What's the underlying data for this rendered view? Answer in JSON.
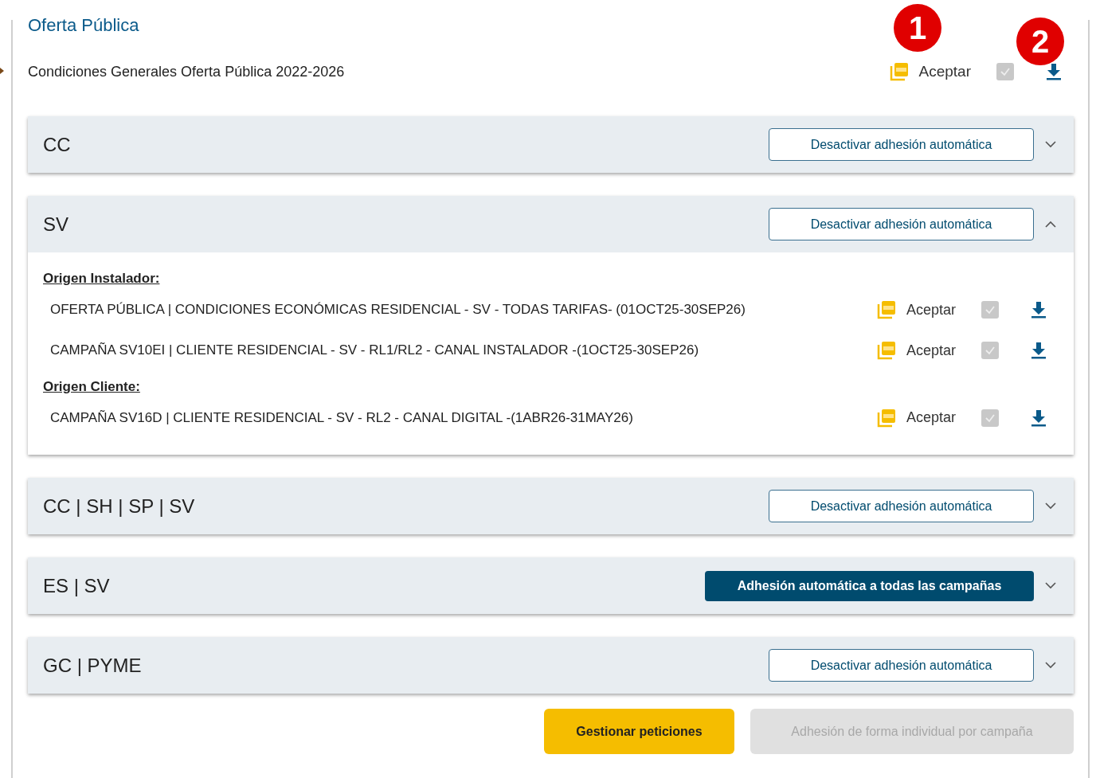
{
  "title": "Oferta Pública",
  "general": {
    "label": "Condiciones Generales Oferta Pública 2022-2026",
    "accept_label": "Aceptar",
    "accepted": true,
    "disabled": true
  },
  "annotations": [
    "1",
    "2"
  ],
  "sections": [
    {
      "title": "CC",
      "expanded": false,
      "button": {
        "kind": "outline",
        "label": "Desactivar adhesión automática"
      }
    },
    {
      "title": "SV",
      "expanded": true,
      "button": {
        "kind": "outline",
        "label": "Desactivar adhesión automática"
      },
      "groups": [
        {
          "heading": "Origen Instalador:",
          "items": [
            {
              "label": "OFERTA PÚBLICA | CONDICIONES ECONÓMICAS RESIDENCIAL - SV - TODAS TARIFAS- (01OCT25-30SEP26)",
              "accept_label": "Aceptar",
              "accepted": true,
              "disabled": true
            },
            {
              "label": "CAMPAÑA SV10EI | CLIENTE RESIDENCIAL - SV - RL1/RL2 - CANAL INSTALADOR -(1OCT25-30SEP26)",
              "accept_label": "Aceptar",
              "accepted": true,
              "disabled": true
            }
          ]
        },
        {
          "heading": "Origen Cliente:",
          "items": [
            {
              "label": "CAMPAÑA SV16D | CLIENTE RESIDENCIAL - SV - RL2 - CANAL DIGITAL -(1ABR26-31MAY26)",
              "accept_label": "Aceptar",
              "accepted": true,
              "disabled": true
            }
          ]
        }
      ]
    },
    {
      "title": "CC | SH | SP | SV",
      "expanded": false,
      "button": {
        "kind": "outline",
        "label": "Desactivar adhesión automática"
      }
    },
    {
      "title": "ES | SV",
      "expanded": false,
      "button": {
        "kind": "filled",
        "label": "Adhesión automática a todas las campañas"
      }
    },
    {
      "title": "GC | PYME",
      "expanded": false,
      "button": {
        "kind": "outline",
        "label": "Desactivar adhesión automática"
      }
    }
  ],
  "footer_buttons": [
    {
      "label": "Gestionar peticiones",
      "disabled": false
    },
    {
      "label": "Adhesión de forma individual por campaña",
      "disabled": true
    }
  ]
}
